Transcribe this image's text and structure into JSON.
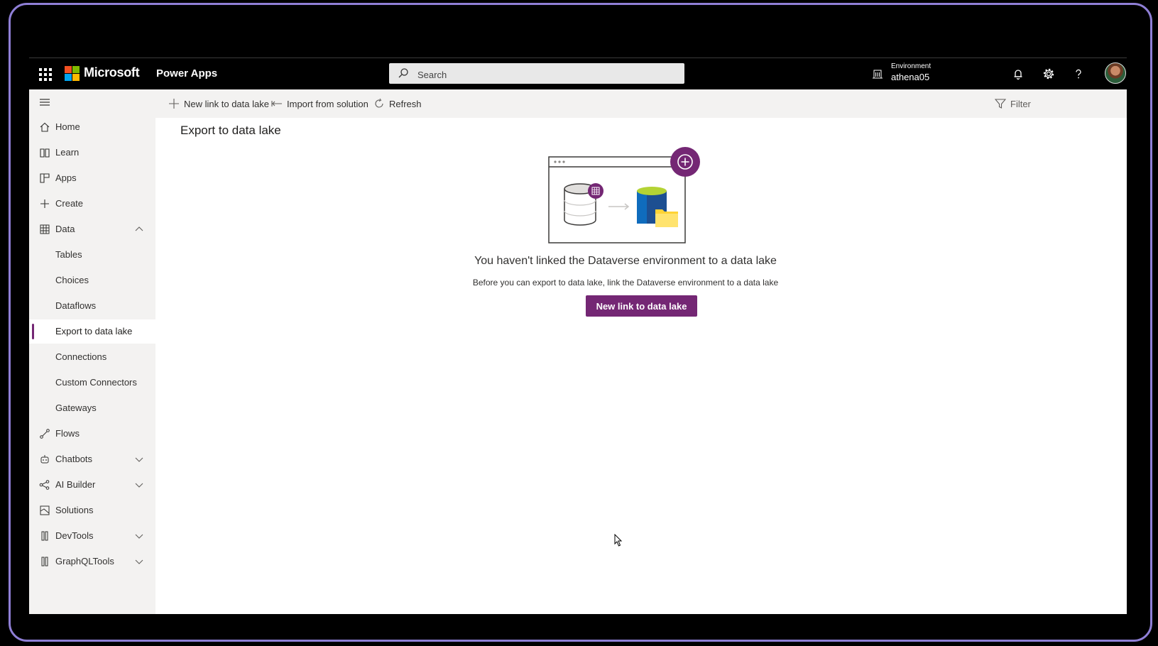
{
  "header": {
    "brand": "Microsoft",
    "app_name": "Power Apps",
    "search_placeholder": "Search",
    "environment_label": "Environment",
    "environment_name": "athena05"
  },
  "sidebar": {
    "items": [
      {
        "label": "Home",
        "icon": "home-icon"
      },
      {
        "label": "Learn",
        "icon": "book-icon"
      },
      {
        "label": "Apps",
        "icon": "apps-icon"
      },
      {
        "label": "Create",
        "icon": "plus-icon"
      },
      {
        "label": "Data",
        "icon": "table-icon",
        "expanded": true
      },
      {
        "label": "Tables"
      },
      {
        "label": "Choices"
      },
      {
        "label": "Dataflows"
      },
      {
        "label": "Export to data lake",
        "active": true
      },
      {
        "label": "Connections"
      },
      {
        "label": "Custom Connectors"
      },
      {
        "label": "Gateways"
      },
      {
        "label": "Flows",
        "icon": "flow-icon"
      },
      {
        "label": "Chatbots",
        "icon": "bot-icon",
        "expandable": true
      },
      {
        "label": "AI Builder",
        "icon": "ai-icon",
        "expandable": true
      },
      {
        "label": "Solutions",
        "icon": "solutions-icon"
      },
      {
        "label": "DevTools",
        "icon": "devtools-icon",
        "expandable": true
      },
      {
        "label": "GraphQLTools",
        "icon": "graphql-icon",
        "expandable": true
      }
    ]
  },
  "commands": {
    "new_link": "New link to data lake",
    "import": "Import from solution",
    "refresh": "Refresh",
    "filter": "Filter"
  },
  "main": {
    "title": "Export to data lake",
    "empty_title": "You haven't linked the Dataverse environment to a data lake",
    "empty_subtitle": "Before you can export to data lake, link the Dataverse environment to a data lake",
    "primary_button": "New link to data lake"
  },
  "colors": {
    "accent": "#742774",
    "sidebar_bg": "#f3f2f1"
  }
}
